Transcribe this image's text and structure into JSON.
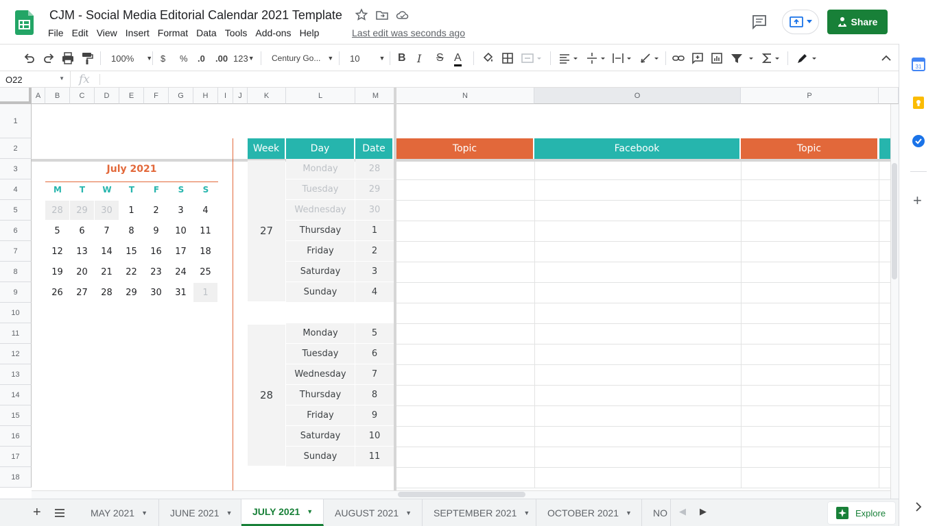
{
  "header": {
    "title": "CJM - Social Media Editorial Calendar 2021 Template",
    "last_edit": "Last edit was seconds ago",
    "share_label": "Share",
    "menu": [
      "File",
      "Edit",
      "View",
      "Insert",
      "Format",
      "Data",
      "Tools",
      "Add-ons",
      "Help"
    ]
  },
  "toolbar": {
    "zoom": "100%",
    "currency": "$",
    "percent": "%",
    "dec_less": ".0",
    "dec_more": ".00",
    "format_more": "123",
    "font": "Century Go...",
    "font_size": "10",
    "bold": "B",
    "italic": "I",
    "strike": "S",
    "text_color": "A"
  },
  "formula_bar": {
    "name_box": "O22",
    "fx": "fx"
  },
  "grid": {
    "columns": [
      "A",
      "B",
      "C",
      "D",
      "E",
      "F",
      "G",
      "H",
      "I",
      "J",
      "K",
      "L",
      "M",
      "N",
      "O",
      "P"
    ],
    "rows": [
      "1",
      "2",
      "3",
      "4",
      "5",
      "6",
      "7",
      "8",
      "9",
      "10",
      "11",
      "12",
      "13",
      "14",
      "15",
      "16",
      "17",
      "18"
    ],
    "selected_column": "O"
  },
  "calendar": {
    "title": "July 2021",
    "day_headers": [
      "M",
      "T",
      "W",
      "T",
      "F",
      "S",
      "S"
    ],
    "weeks": [
      [
        "28",
        "29",
        "30",
        "1",
        "2",
        "3",
        "4"
      ],
      [
        "5",
        "6",
        "7",
        "8",
        "9",
        "10",
        "11"
      ],
      [
        "12",
        "13",
        "14",
        "15",
        "16",
        "17",
        "18"
      ],
      [
        "19",
        "20",
        "21",
        "22",
        "23",
        "24",
        "25"
      ],
      [
        "26",
        "27",
        "28",
        "29",
        "30",
        "31",
        "1"
      ]
    ]
  },
  "table": {
    "headers": {
      "week": "Week",
      "day": "Day",
      "date": "Date",
      "topic1": "Topic",
      "facebook": "Facebook",
      "topic2": "Topic"
    },
    "week_blocks": [
      {
        "week": "27",
        "days": [
          {
            "day": "Monday",
            "date": "28",
            "muted": true
          },
          {
            "day": "Tuesday",
            "date": "29",
            "muted": true
          },
          {
            "day": "Wednesday",
            "date": "30",
            "muted": true
          },
          {
            "day": "Thursday",
            "date": "1",
            "muted": false
          },
          {
            "day": "Friday",
            "date": "2",
            "muted": false
          },
          {
            "day": "Saturday",
            "date": "3",
            "muted": false
          },
          {
            "day": "Sunday",
            "date": "4",
            "muted": false
          }
        ]
      },
      {
        "week": "28",
        "days": [
          {
            "day": "Monday",
            "date": "5",
            "muted": false
          },
          {
            "day": "Tuesday",
            "date": "6",
            "muted": false
          },
          {
            "day": "Wednesday",
            "date": "7",
            "muted": false
          },
          {
            "day": "Thursday",
            "date": "8",
            "muted": false
          },
          {
            "day": "Friday",
            "date": "9",
            "muted": false
          },
          {
            "day": "Saturday",
            "date": "10",
            "muted": false
          },
          {
            "day": "Sunday",
            "date": "11",
            "muted": false
          }
        ]
      }
    ]
  },
  "tabs": {
    "items": [
      "MAY 2021",
      "JUNE 2021",
      "JULY 2021",
      "AUGUST 2021",
      "SEPTEMBER 2021",
      "OCTOBER 2021",
      "NO"
    ],
    "active": "JULY 2021",
    "explore_label": "Explore"
  },
  "colors": {
    "teal": "#26b5ad",
    "orange": "#e2683a",
    "share_green": "#188038"
  }
}
